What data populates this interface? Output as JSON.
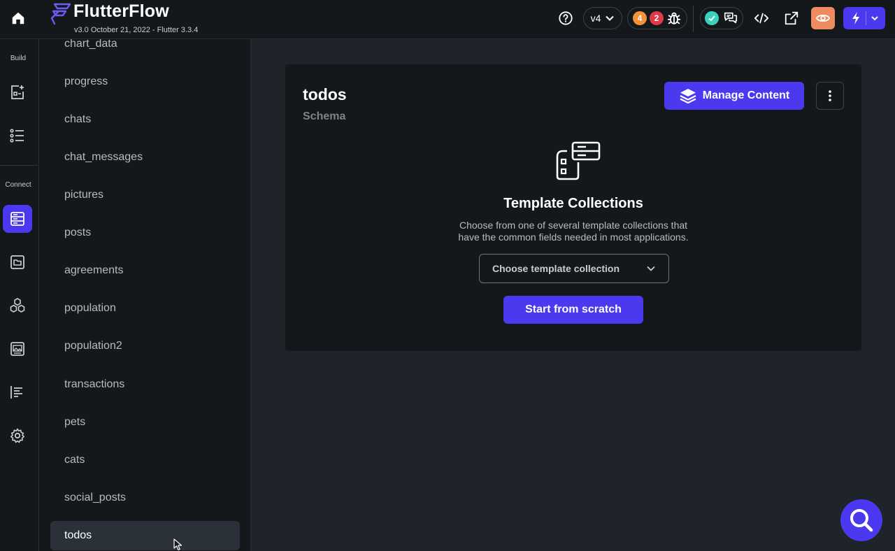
{
  "header": {
    "brand": "FlutterFlow",
    "version_info": "v3.0 October 21, 2022 - Flutter 3.3.4",
    "branch": "v4",
    "warning_count": "4",
    "error_count": "2"
  },
  "rail": {
    "build_label": "Build",
    "connect_label": "Connect"
  },
  "collections": [
    "chart_data",
    "progress",
    "chats",
    "chat_messages",
    "pictures",
    "posts",
    "agreements",
    "population",
    "population2",
    "transactions",
    "pets",
    "cats",
    "social_posts",
    "todos"
  ],
  "selected_collection": "todos",
  "main": {
    "title": "todos",
    "subtitle": "Schema",
    "manage_label": "Manage Content",
    "template_title": "Template Collections",
    "template_desc": "Choose from one of several template collections that have the common fields needed in most applications.",
    "template_select_placeholder": "Choose template collection",
    "scratch_label": "Start from scratch"
  },
  "colors": {
    "primary": "#4b39ef",
    "preview": "#ee8b60",
    "warning": "#f39237",
    "error": "#e0394a",
    "success": "#39d2c0",
    "background": "#1e2429",
    "panel": "#14181b"
  }
}
